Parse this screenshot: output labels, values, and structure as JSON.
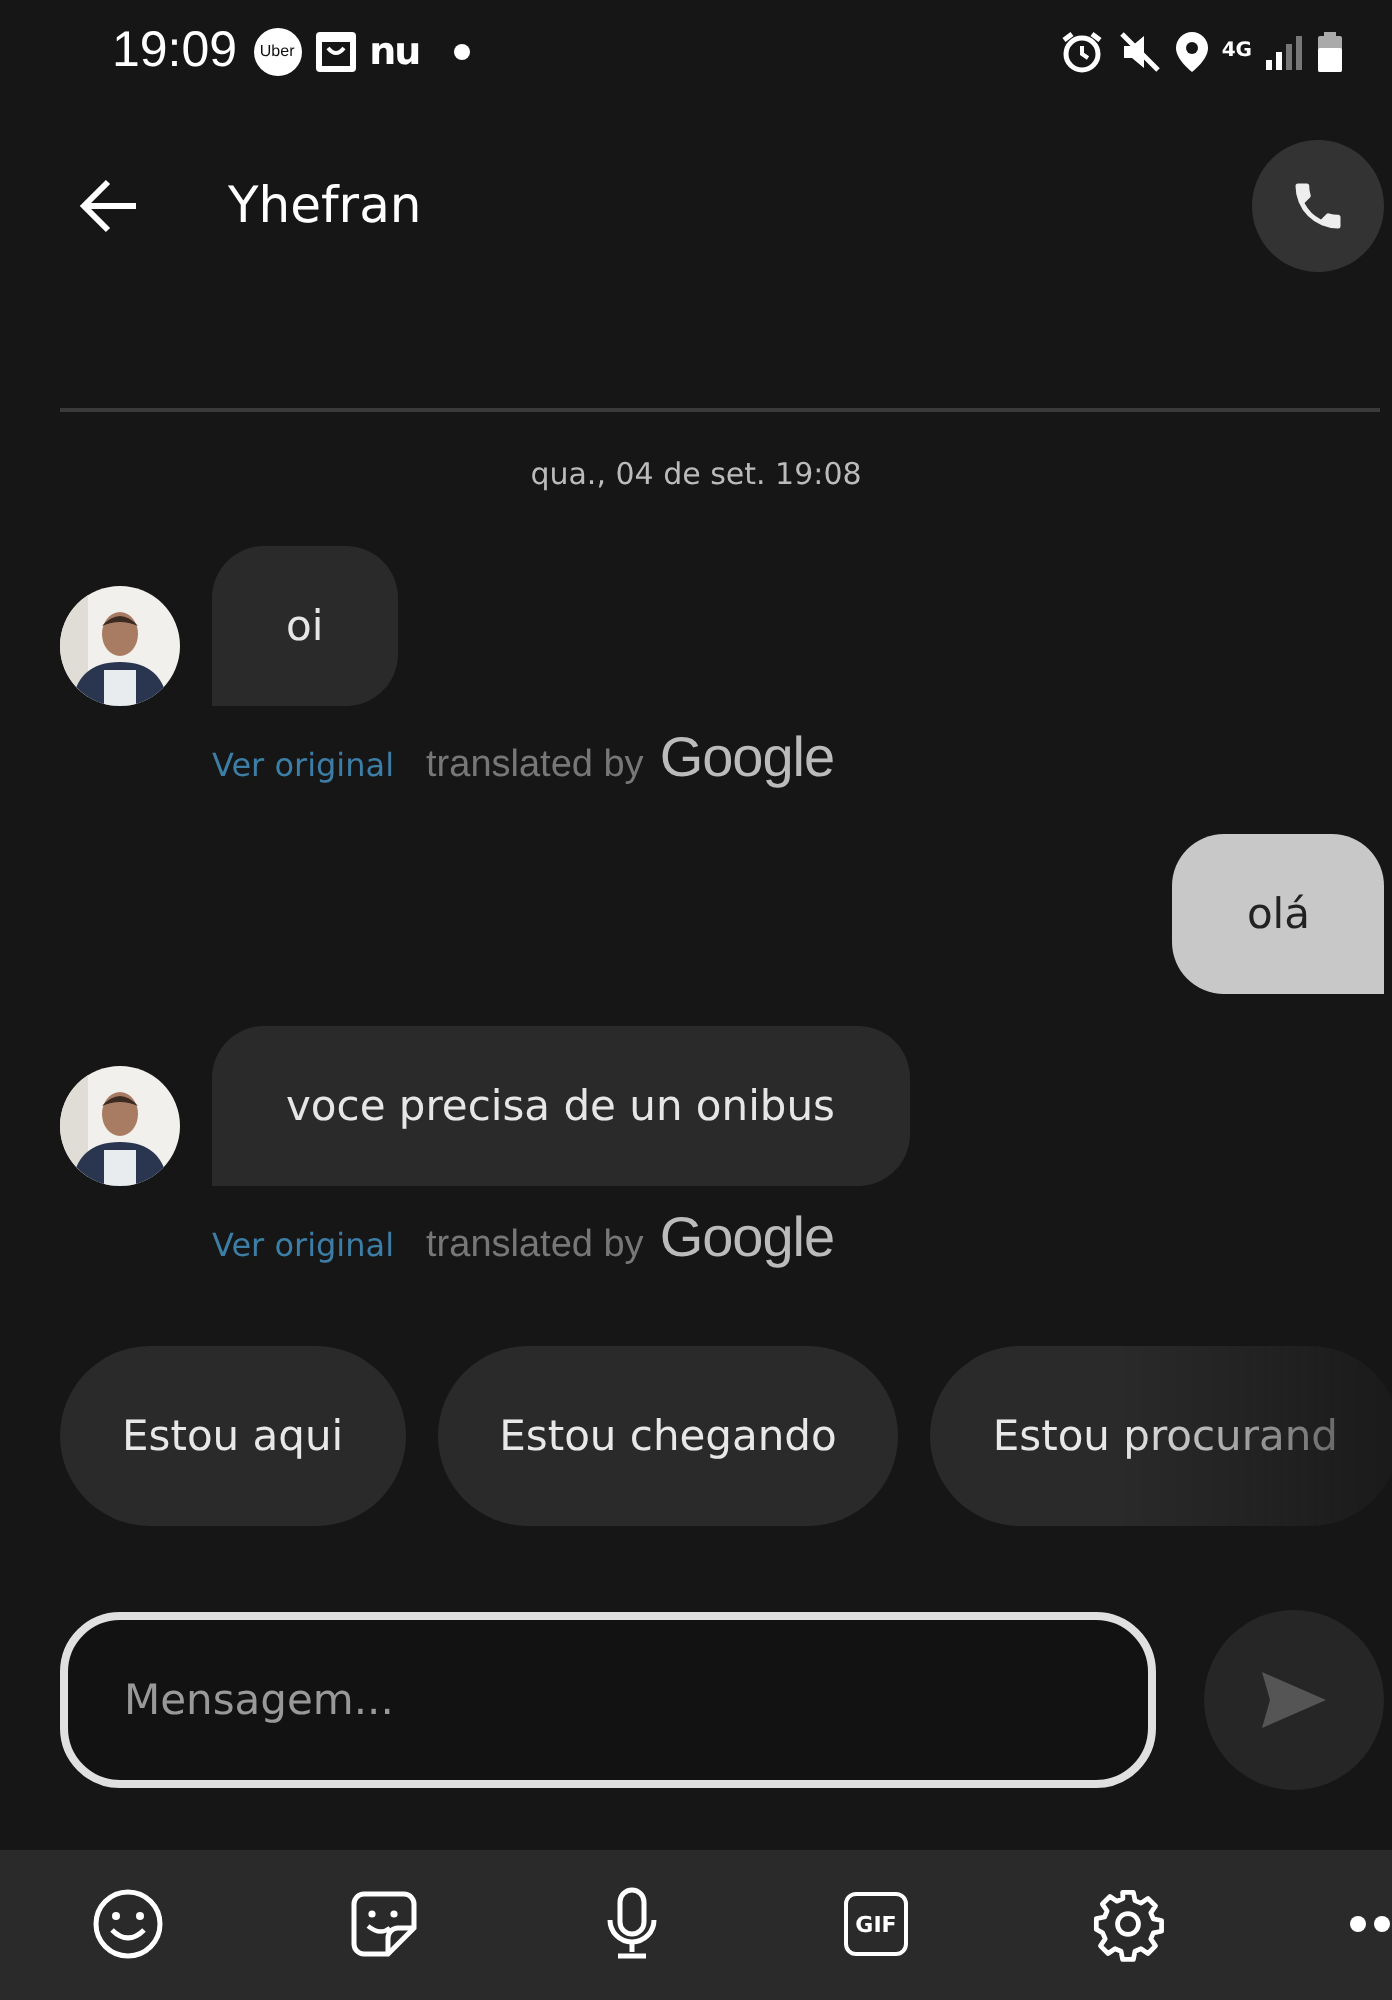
{
  "status_bar": {
    "time": "19:09",
    "app_icons": [
      "Uber",
      "nu"
    ],
    "network": "4G"
  },
  "header": {
    "title": "Yhefran"
  },
  "date_separator": "qua., 04 de set. 19:08",
  "messages": [
    {
      "kind": "received",
      "text": "oi",
      "ver_original": "Ver original",
      "translated_by": "translated by",
      "brand": "Google"
    },
    {
      "kind": "sent",
      "text": "olá"
    },
    {
      "kind": "received",
      "text": "voce precisa de un onibus",
      "ver_original": "Ver original",
      "translated_by": "translated by",
      "brand": "Google"
    }
  ],
  "quick_replies": [
    "Estou aqui",
    "Estou chegando",
    "Estou procurand"
  ],
  "composer": {
    "placeholder": "Mensagem..."
  },
  "keyboard_toolbar": {
    "gif_label": "GIF"
  }
}
